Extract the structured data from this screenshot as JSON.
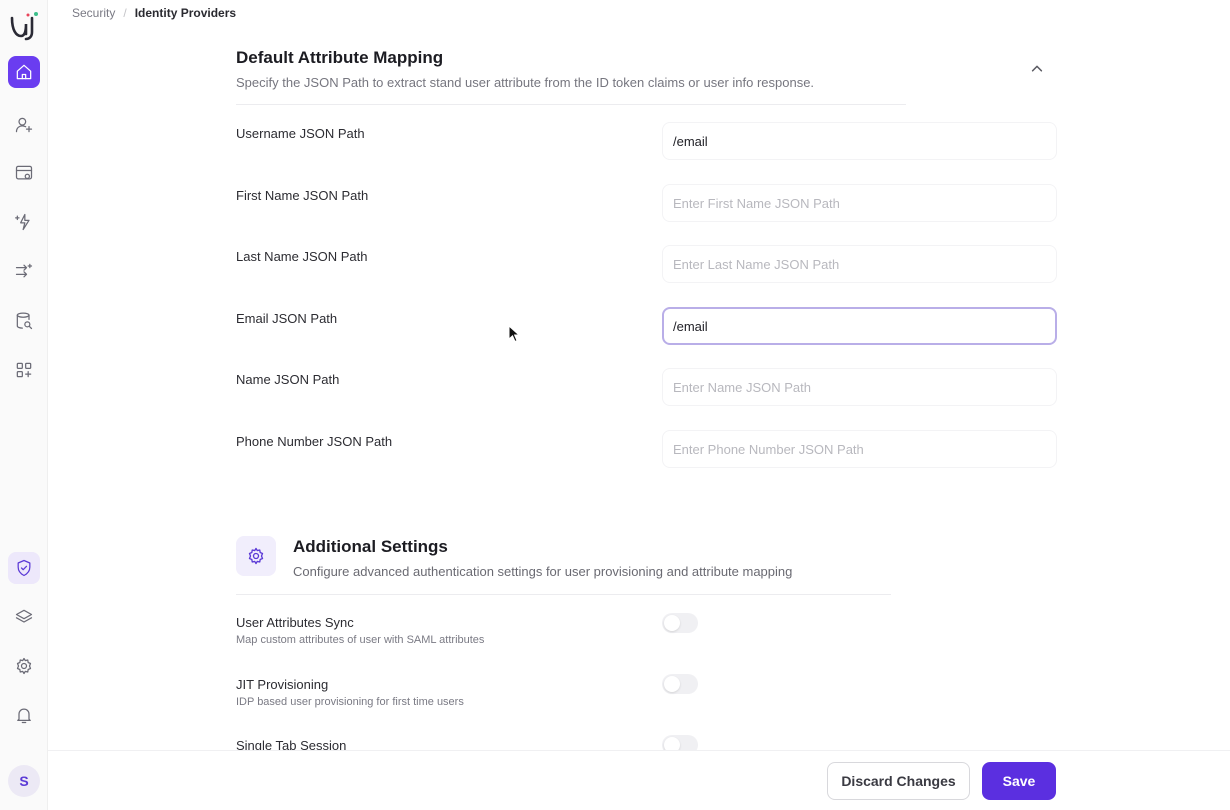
{
  "breadcrumb": {
    "parent": "Security",
    "separator": "/",
    "current": "Identity Providers"
  },
  "mapping": {
    "title": "Default Attribute Mapping",
    "description": "Specify the JSON Path to extract stand user attribute from the ID token claims or user info response.",
    "fields": [
      {
        "label": "Username JSON Path",
        "value": "/email",
        "placeholder": ""
      },
      {
        "label": "First Name JSON Path",
        "value": "",
        "placeholder": "Enter First Name JSON Path"
      },
      {
        "label": "Last Name JSON Path",
        "value": "",
        "placeholder": "Enter Last Name JSON Path"
      },
      {
        "label": "Email JSON Path",
        "value": "/email",
        "placeholder": ""
      },
      {
        "label": "Name JSON Path",
        "value": "",
        "placeholder": "Enter Name JSON Path"
      },
      {
        "label": "Phone Number JSON Path",
        "value": "",
        "placeholder": "Enter Phone Number JSON Path"
      }
    ]
  },
  "additional": {
    "title": "Additional Settings",
    "description": "Configure advanced authentication settings for user provisioning and attribute mapping",
    "toggles": [
      {
        "label": "User Attributes Sync",
        "description": "Map custom attributes of user with SAML attributes",
        "enabled": false
      },
      {
        "label": "JIT Provisioning",
        "description": "IDP based user provisioning for first time users",
        "enabled": false
      },
      {
        "label": "Single Tab Session",
        "description": "",
        "enabled": false
      }
    ]
  },
  "footer": {
    "discard_label": "Discard Changes",
    "save_label": "Save"
  },
  "user": {
    "initial": "S"
  },
  "colors": {
    "accent": "#5b2fe0",
    "accent_soft": "#ede8fb"
  },
  "sidebar": {
    "icons": [
      "home-icon",
      "user-plus-icon",
      "app-window-icon",
      "sparkle-bolt-icon",
      "flow-icon",
      "database-search-icon",
      "apps-add-icon",
      "shield-icon",
      "layers-icon",
      "gear-icon",
      "bell-icon"
    ]
  }
}
